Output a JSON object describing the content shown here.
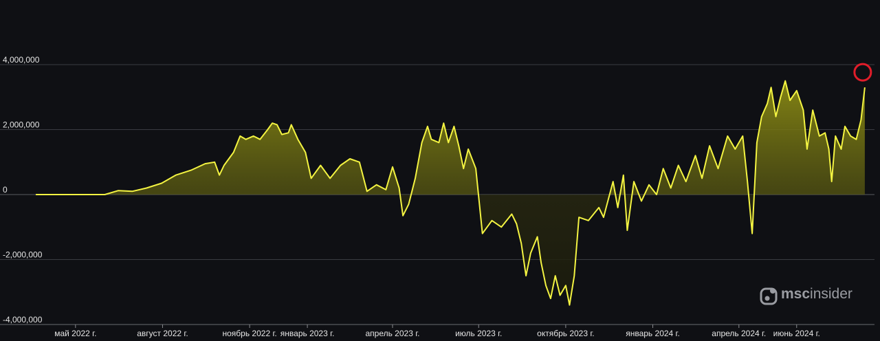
{
  "chart_data": {
    "type": "area",
    "title": "",
    "xlabel": "",
    "ylabel": "",
    "ylim": [
      -4000000,
      4000000
    ],
    "grid": true,
    "legend": "none",
    "line_color": "#f4f442",
    "fill_color_top": "#8a8a14",
    "fill_color_bottom": "#1a1a0c",
    "highlight_color": "#e11d2a",
    "y_ticks": [
      {
        "value": 4000000,
        "label": "4,000,000"
      },
      {
        "value": 2000000,
        "label": "2,000,000"
      },
      {
        "value": 0,
        "label": "0"
      },
      {
        "value": -2000000,
        "label": "-2,000,000"
      },
      {
        "value": -4000000,
        "label": "-4,000,000"
      }
    ],
    "x_ticks": [
      {
        "date": "2022-05-01",
        "label": "май 2022 г."
      },
      {
        "date": "2022-08-01",
        "label": "август 2022 г."
      },
      {
        "date": "2022-11-01",
        "label": "ноябрь 2022 г."
      },
      {
        "date": "2023-01-01",
        "label": "январь 2023 г."
      },
      {
        "date": "2023-04-01",
        "label": "апрель 2023 г."
      },
      {
        "date": "2023-07-01",
        "label": "июль 2023 г."
      },
      {
        "date": "2023-10-01",
        "label": "октябрь 2023 г."
      },
      {
        "date": "2024-01-01",
        "label": "январь 2024 г."
      },
      {
        "date": "2024-04-01",
        "label": "апрель 2024 г."
      },
      {
        "date": "2024-06-01",
        "label": "июнь 2024 г."
      }
    ],
    "x_range": [
      "2022-03-20",
      "2024-08-15"
    ],
    "series": [
      {
        "points": [
          [
            "2022-03-20",
            0
          ],
          [
            "2022-04-15",
            0
          ],
          [
            "2022-05-10",
            0
          ],
          [
            "2022-06-01",
            0
          ],
          [
            "2022-06-15",
            120000
          ],
          [
            "2022-06-30",
            100000
          ],
          [
            "2022-07-15",
            200000
          ],
          [
            "2022-07-31",
            350000
          ],
          [
            "2022-08-15",
            600000
          ],
          [
            "2022-08-31",
            750000
          ],
          [
            "2022-09-15",
            950000
          ],
          [
            "2022-09-25",
            1000000
          ],
          [
            "2022-09-30",
            600000
          ],
          [
            "2022-10-05",
            900000
          ],
          [
            "2022-10-15",
            1300000
          ],
          [
            "2022-10-22",
            1800000
          ],
          [
            "2022-10-28",
            1700000
          ],
          [
            "2022-11-05",
            1800000
          ],
          [
            "2022-11-12",
            1700000
          ],
          [
            "2022-11-20",
            2000000
          ],
          [
            "2022-11-25",
            2200000
          ],
          [
            "2022-11-30",
            2150000
          ],
          [
            "2022-12-05",
            1850000
          ],
          [
            "2022-12-12",
            1900000
          ],
          [
            "2022-12-15",
            2150000
          ],
          [
            "2022-12-22",
            1700000
          ],
          [
            "2022-12-30",
            1300000
          ],
          [
            "2023-01-05",
            500000
          ],
          [
            "2023-01-15",
            900000
          ],
          [
            "2023-01-25",
            500000
          ],
          [
            "2023-02-05",
            900000
          ],
          [
            "2023-02-15",
            1100000
          ],
          [
            "2023-02-25",
            1000000
          ],
          [
            "2023-03-05",
            100000
          ],
          [
            "2023-03-15",
            300000
          ],
          [
            "2023-03-25",
            150000
          ],
          [
            "2023-04-01",
            850000
          ],
          [
            "2023-04-08",
            200000
          ],
          [
            "2023-04-12",
            -650000
          ],
          [
            "2023-04-18",
            -300000
          ],
          [
            "2023-04-25",
            500000
          ],
          [
            "2023-05-02",
            1600000
          ],
          [
            "2023-05-08",
            2100000
          ],
          [
            "2023-05-12",
            1700000
          ],
          [
            "2023-05-20",
            1600000
          ],
          [
            "2023-05-25",
            2200000
          ],
          [
            "2023-05-30",
            1600000
          ],
          [
            "2023-06-05",
            2100000
          ],
          [
            "2023-06-10",
            1500000
          ],
          [
            "2023-06-15",
            800000
          ],
          [
            "2023-06-20",
            1400000
          ],
          [
            "2023-06-28",
            800000
          ],
          [
            "2023-07-05",
            -1200000
          ],
          [
            "2023-07-15",
            -800000
          ],
          [
            "2023-07-25",
            -1000000
          ],
          [
            "2023-08-05",
            -600000
          ],
          [
            "2023-08-10",
            -900000
          ],
          [
            "2023-08-15",
            -1500000
          ],
          [
            "2023-08-20",
            -2500000
          ],
          [
            "2023-08-25",
            -1800000
          ],
          [
            "2023-09-01",
            -1300000
          ],
          [
            "2023-09-05",
            -2100000
          ],
          [
            "2023-09-10",
            -2800000
          ],
          [
            "2023-09-15",
            -3200000
          ],
          [
            "2023-09-20",
            -2500000
          ],
          [
            "2023-09-25",
            -3100000
          ],
          [
            "2023-10-01",
            -2800000
          ],
          [
            "2023-10-05",
            -3400000
          ],
          [
            "2023-10-10",
            -2500000
          ],
          [
            "2023-10-15",
            -700000
          ],
          [
            "2023-10-25",
            -800000
          ],
          [
            "2023-11-05",
            -400000
          ],
          [
            "2023-11-10",
            -700000
          ],
          [
            "2023-11-20",
            400000
          ],
          [
            "2023-11-25",
            -400000
          ],
          [
            "2023-12-01",
            600000
          ],
          [
            "2023-12-05",
            -1100000
          ],
          [
            "2023-12-12",
            400000
          ],
          [
            "2023-12-20",
            -200000
          ],
          [
            "2023-12-28",
            300000
          ],
          [
            "2024-01-05",
            0
          ],
          [
            "2024-01-12",
            800000
          ],
          [
            "2024-01-20",
            200000
          ],
          [
            "2024-01-28",
            900000
          ],
          [
            "2024-02-05",
            400000
          ],
          [
            "2024-02-15",
            1200000
          ],
          [
            "2024-02-22",
            500000
          ],
          [
            "2024-03-01",
            1500000
          ],
          [
            "2024-03-10",
            800000
          ],
          [
            "2024-03-20",
            1800000
          ],
          [
            "2024-03-28",
            1400000
          ],
          [
            "2024-04-05",
            1800000
          ],
          [
            "2024-04-10",
            400000
          ],
          [
            "2024-04-15",
            -1200000
          ],
          [
            "2024-04-20",
            1600000
          ],
          [
            "2024-04-25",
            2400000
          ],
          [
            "2024-05-01",
            2800000
          ],
          [
            "2024-05-05",
            3300000
          ],
          [
            "2024-05-10",
            2400000
          ],
          [
            "2024-05-15",
            3000000
          ],
          [
            "2024-05-20",
            3500000
          ],
          [
            "2024-05-25",
            2900000
          ],
          [
            "2024-06-01",
            3200000
          ],
          [
            "2024-06-08",
            2600000
          ],
          [
            "2024-06-12",
            1400000
          ],
          [
            "2024-06-18",
            2600000
          ],
          [
            "2024-06-25",
            1800000
          ],
          [
            "2024-07-01",
            1900000
          ],
          [
            "2024-07-05",
            1400000
          ],
          [
            "2024-07-08",
            400000
          ],
          [
            "2024-07-12",
            1800000
          ],
          [
            "2024-07-18",
            1400000
          ],
          [
            "2024-07-22",
            2100000
          ],
          [
            "2024-07-28",
            1800000
          ],
          [
            "2024-08-03",
            1700000
          ],
          [
            "2024-08-08",
            2300000
          ],
          [
            "2024-08-12",
            3300000
          ]
        ]
      }
    ],
    "highlight_point": [
      "2024-08-12",
      3300000
    ],
    "watermark": "mscinsider",
    "watermark_parts": {
      "bold": "msc",
      "regular": "insider"
    }
  }
}
